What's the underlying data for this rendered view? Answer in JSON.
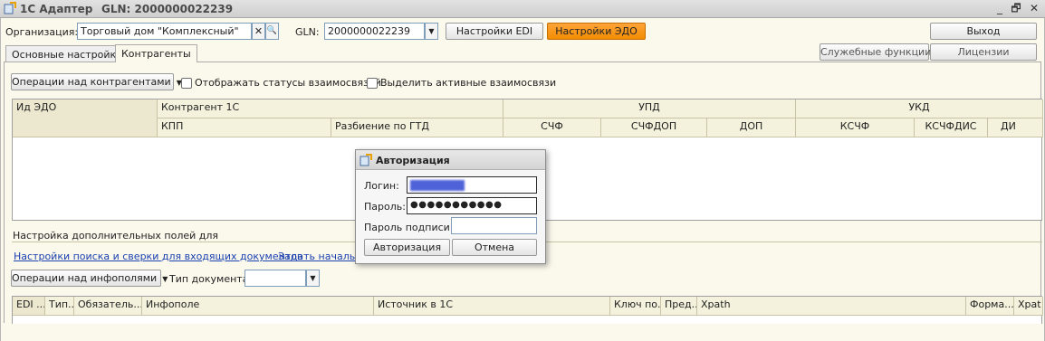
{
  "window": {
    "app_title": "1С Адаптер",
    "gln_title": "GLN: 2000000022239",
    "minimize": "_",
    "restore": "🗗",
    "close": "✕"
  },
  "toolbar": {
    "org_label": "Организация:",
    "org_value": "Торговый дом \"Комплексный\"",
    "clear_glyph": "✕",
    "search_glyph": "🔍",
    "gln_label": "GLN:",
    "gln_value": "2000000022239",
    "dropdown_glyph": "▼",
    "edi_settings": "Настройки EDI",
    "edo_settings": "Настройки ЭДО",
    "exit": "Выход",
    "service_functions": "Служебные функции",
    "licenses": "Лицензии"
  },
  "tabs": [
    {
      "label": "Основные настройки",
      "active": false
    },
    {
      "label": "Контрагенты",
      "active": true
    }
  ],
  "contractors": {
    "ops_button": "Операции над контрагентами",
    "show_statuses": "Отображать статусы взаимосвязей",
    "highlight_active": "Выделить активные взаимосвязи",
    "headers": {
      "id_edo": "Ид ЭДО",
      "contractor": "Контрагент 1С",
      "kpp": "КПП",
      "gtd_split": "Разбиение по ГТД",
      "upd": "УПД",
      "ukd": "УКД",
      "schf": "СЧФ",
      "schfdop": "СЧФДОП",
      "dop": "ДОП",
      "kschf": "КСЧФ",
      "kschfdis": "КСЧФДИС",
      "di": "ДИ"
    }
  },
  "extra_fields": {
    "section_label": "Настройка дополнительных полей для",
    "link_search": "Настройки поиска и сверки для входящих документов",
    "link_initial": "Задать начальное",
    "ops_button": "Операции над инфополями",
    "doc_type_label": "Тип документа:",
    "doc_type_value": "",
    "headers": [
      "EDI ...",
      "Тип...",
      "Обязатель...",
      "Инфополе",
      "Источник в 1С",
      "Ключ по...",
      "Пред...",
      "Xpath",
      "Форма...",
      "Xpat"
    ]
  },
  "auth_dialog": {
    "title": "Авторизация",
    "login_label": "Логин:",
    "login_value": "",
    "password_label": "Пароль:",
    "password_value": "●●●●●●●●●●●",
    "sign_password_label": "Пароль подписи:",
    "sign_password_value": "",
    "login_button": "Авторизация",
    "cancel_button": "Отмена"
  },
  "colors": {
    "accent_orange": "#f28c00",
    "link_blue": "#1a3fb0",
    "background": "#fbf9ec"
  }
}
